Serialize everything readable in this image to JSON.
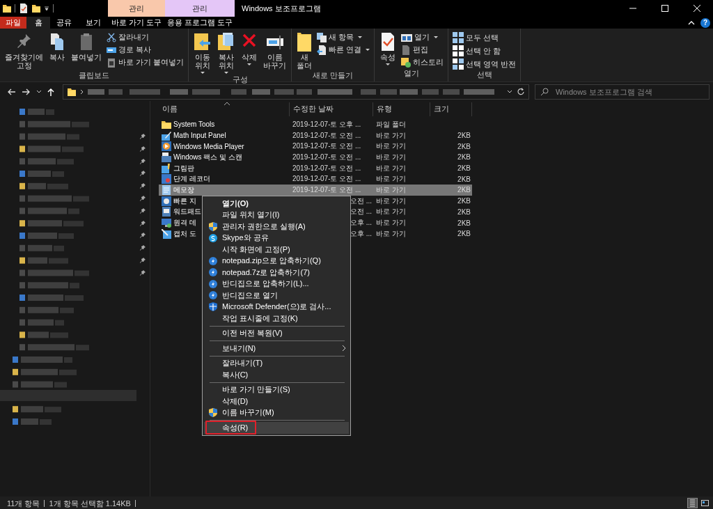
{
  "title_bar": {
    "context_headers": [
      {
        "label": "관리",
        "color": "#f9c8ab"
      },
      {
        "label": "관리",
        "color": "#e4c6f7"
      }
    ],
    "title": "Windows 보조프로그램"
  },
  "tabs": [
    {
      "label": "파일",
      "kind": "file",
      "selected": false
    },
    {
      "label": "홈",
      "kind": "tab",
      "selected": true
    },
    {
      "label": "공유",
      "kind": "tab",
      "selected": false
    },
    {
      "label": "보기",
      "kind": "tab",
      "selected": false
    },
    {
      "label": "바로 가기 도구",
      "kind": "tab",
      "selected": false
    },
    {
      "label": "응용 프로그램 도구",
      "kind": "tab",
      "selected": false
    }
  ],
  "help": "?",
  "ribbon": [
    {
      "label": "클립보드",
      "items": [
        {
          "label": "즐겨찾기에\n고정",
          "kind": "large",
          "dropdown": false
        },
        {
          "label": "복사",
          "kind": "large",
          "dropdown": false
        },
        {
          "label": "붙여넣기",
          "kind": "large",
          "dropdown": false
        },
        {
          "label": "잘라내기",
          "kind": "small",
          "dropdown": false
        },
        {
          "label": "경로 복사",
          "kind": "small",
          "dropdown": false
        },
        {
          "label": "바로 가기 붙여넣기",
          "kind": "small",
          "dropdown": false
        }
      ]
    },
    {
      "label": "구성",
      "items": [
        {
          "label": "이동\n위치",
          "kind": "large",
          "dropdown": true
        },
        {
          "label": "복사\n위치",
          "kind": "large",
          "dropdown": true
        },
        {
          "label": "삭제",
          "kind": "large",
          "dropdown": true
        },
        {
          "label": "이름\n바꾸기",
          "kind": "large",
          "dropdown": false
        }
      ]
    },
    {
      "label": "새로 만들기",
      "items": [
        {
          "label": "새\n폴더",
          "kind": "large",
          "dropdown": false
        },
        {
          "label": "새 항목",
          "kind": "small",
          "dropdown": true
        },
        {
          "label": "빠른 연결",
          "kind": "small",
          "dropdown": true
        }
      ]
    },
    {
      "label": "열기",
      "items": [
        {
          "label": "속성",
          "kind": "large",
          "dropdown": true
        },
        {
          "label": "열기",
          "kind": "small",
          "dropdown": true
        },
        {
          "label": "편집",
          "kind": "small",
          "dropdown": false
        },
        {
          "label": "히스토리",
          "kind": "small",
          "dropdown": false
        }
      ]
    },
    {
      "label": "선택",
      "items": [
        {
          "label": "모두 선택",
          "kind": "small",
          "dropdown": false
        },
        {
          "label": "선택 안 함",
          "kind": "small",
          "dropdown": false
        },
        {
          "label": "선택 영역 반전",
          "kind": "small",
          "dropdown": false
        }
      ]
    }
  ],
  "search": {
    "placeholder": "Windows 보조프로그램 검색"
  },
  "navigation_pane": {
    "kind": "picture",
    "items": [
      {
        "pinned": false
      },
      {
        "pinned": false
      },
      {
        "pinned": true
      },
      {
        "pinned": true
      },
      {
        "pinned": true
      },
      {
        "pinned": true
      },
      {
        "pinned": true
      },
      {
        "pinned": true
      },
      {
        "pinned": true
      },
      {
        "pinned": true
      },
      {
        "pinned": true
      },
      {
        "pinned": true
      },
      {
        "pinned": true
      },
      {
        "pinned": true
      },
      {
        "pinned": false
      },
      {
        "pinned": false
      },
      {
        "pinned": false
      },
      {
        "pinned": false
      },
      {
        "pinned": false
      },
      {
        "pinned": false
      },
      {
        "pinned": false
      },
      {
        "pinned": false
      },
      {
        "pinned": false
      },
      {
        "pinned": false
      },
      {
        "pinned": false
      },
      {
        "pinned": false
      }
    ]
  },
  "table": {
    "columns": [
      {
        "label": "이름",
        "sorted": true
      },
      {
        "label": "수정한 날짜",
        "sorted": false
      },
      {
        "label": "유형",
        "sorted": false
      },
      {
        "label": "크기",
        "sorted": false
      }
    ],
    "rows": [
      {
        "name": "System Tools",
        "date": "2019-12-07-토 오후 ...",
        "type": "파일 폴더",
        "size": "",
        "selected": false,
        "covered": false
      },
      {
        "name": "Math Input Panel",
        "date": "2019-12-07-토 오전 ...",
        "type": "바로 가기",
        "size": "2KB",
        "selected": false,
        "covered": false
      },
      {
        "name": "Windows Media Player",
        "date": "2019-12-07-토 오전 ...",
        "type": "바로 가기",
        "size": "2KB",
        "selected": false,
        "covered": false
      },
      {
        "name": "Windows 팩스 및 스캔",
        "date": "2019-12-07-토 오전 ...",
        "type": "바로 가기",
        "size": "2KB",
        "selected": false,
        "covered": false
      },
      {
        "name": "그림판",
        "date": "2019-12-07-토 오전 ...",
        "type": "바로 가기",
        "size": "2KB",
        "selected": false,
        "covered": false
      },
      {
        "name": "단계 레코더",
        "date": "2019-12-07-토 오전 ...",
        "type": "바로 가기",
        "size": "2KB",
        "selected": false,
        "covered": false
      },
      {
        "name": "메모장",
        "date": "2019-12-07-토 오전 ...",
        "type": "바로 가기",
        "size": "2KB",
        "selected": true,
        "covered": false
      },
      {
        "name": "빠른 지",
        "date": "오전 ...",
        "type": "바로 가기",
        "size": "2KB",
        "selected": false,
        "covered": true
      },
      {
        "name": "워드패드",
        "date": "오전 ...",
        "type": "바로 가기",
        "size": "2KB",
        "selected": false,
        "covered": true
      },
      {
        "name": "원격 데",
        "date": "오후 ...",
        "type": "바로 가기",
        "size": "2KB",
        "selected": false,
        "covered": true
      },
      {
        "name": "캡처 도",
        "date": "오후 ...",
        "type": "바로 가기",
        "size": "2KB",
        "selected": false,
        "covered": true
      }
    ]
  },
  "context_menu": [
    {
      "kind": "item",
      "label": "열기(O)",
      "default": true,
      "selected": false,
      "outlined": false
    },
    {
      "kind": "item",
      "label": "파일 위치 열기(I)",
      "default": false,
      "selected": false,
      "outlined": false
    },
    {
      "kind": "item",
      "label": "관리자 권한으로 실행(A)",
      "default": false,
      "selected": false,
      "outlined": false
    },
    {
      "kind": "item",
      "label": "Skype와 공유",
      "default": false,
      "selected": false,
      "outlined": false
    },
    {
      "kind": "item",
      "label": "시작 화면에 고정(P)",
      "default": false,
      "selected": false,
      "outlined": false
    },
    {
      "kind": "item",
      "label": "notepad.zip으로 압축하기(Q)",
      "default": false,
      "selected": false,
      "outlined": false
    },
    {
      "kind": "item",
      "label": "notepad.7z로 압축하기(7)",
      "default": false,
      "selected": false,
      "outlined": false
    },
    {
      "kind": "item",
      "label": "반디집으로 압축하기(L)...",
      "default": false,
      "selected": false,
      "outlined": false
    },
    {
      "kind": "item",
      "label": "반디집으로 열기",
      "default": false,
      "selected": false,
      "outlined": false
    },
    {
      "kind": "item",
      "label": "Microsoft Defender(으)로 검사...",
      "default": false,
      "selected": false,
      "outlined": false
    },
    {
      "kind": "item",
      "label": "작업 표시줄에 고정(K)",
      "default": false,
      "selected": false,
      "outlined": false
    },
    {
      "kind": "separator"
    },
    {
      "kind": "item",
      "label": "이전 버전 복원(V)",
      "default": false,
      "selected": false,
      "outlined": false
    },
    {
      "kind": "separator"
    },
    {
      "kind": "submenu",
      "label": "보내기(N)",
      "default": false,
      "selected": false,
      "outlined": false
    },
    {
      "kind": "separator"
    },
    {
      "kind": "item",
      "label": "잘라내기(T)",
      "default": false,
      "selected": false,
      "outlined": false
    },
    {
      "kind": "item",
      "label": "복사(C)",
      "default": false,
      "selected": false,
      "outlined": false
    },
    {
      "kind": "separator"
    },
    {
      "kind": "item",
      "label": "바로 가기 만들기(S)",
      "default": false,
      "selected": false,
      "outlined": false
    },
    {
      "kind": "item",
      "label": "삭제(D)",
      "default": false,
      "selected": false,
      "outlined": false
    },
    {
      "kind": "item",
      "label": "이름 바꾸기(M)",
      "default": false,
      "selected": false,
      "outlined": false
    },
    {
      "kind": "separator"
    },
    {
      "kind": "item",
      "label": "속성(R)",
      "default": false,
      "selected": true,
      "outlined": true
    }
  ],
  "status_bar": {
    "items": [
      "11개 항목",
      "1개 항목 선택함 1.14KB"
    ],
    "views": [
      {
        "selected": true
      },
      {
        "selected": false
      }
    ]
  }
}
